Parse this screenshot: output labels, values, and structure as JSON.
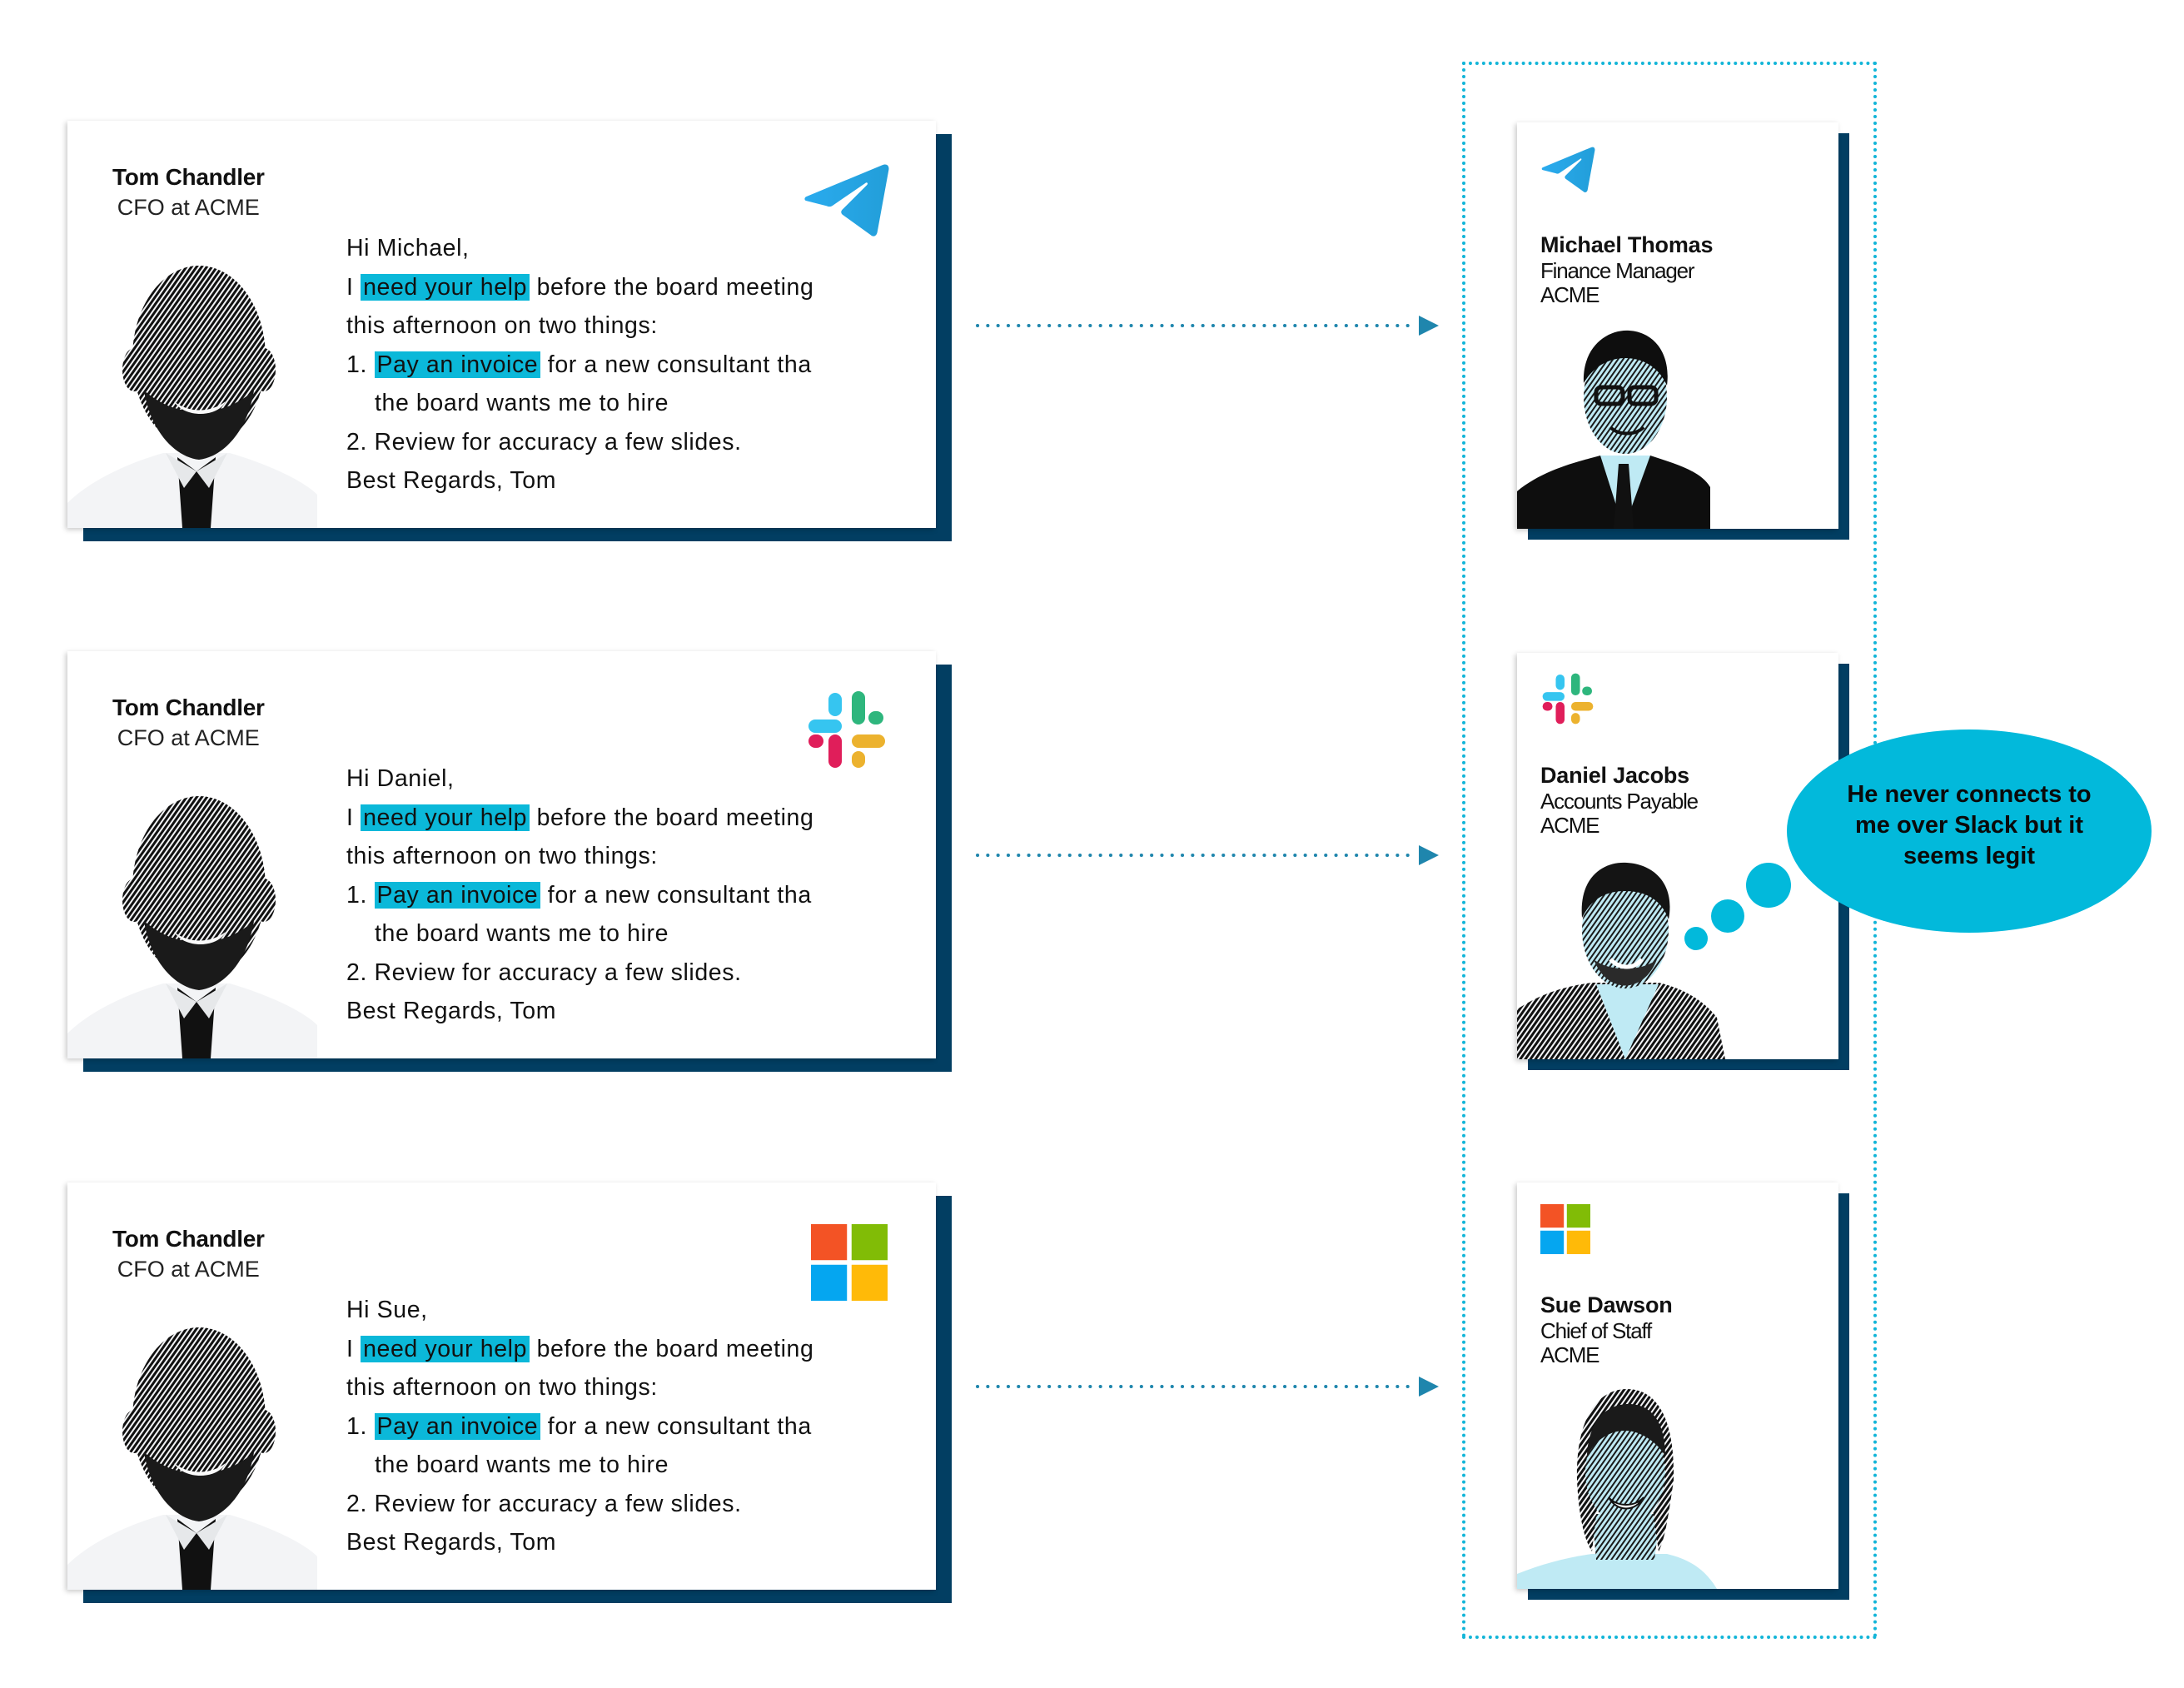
{
  "colors": {
    "highlight": "#0bb8d9",
    "card_shadow": "#023e62",
    "arrow": "#1f86ad",
    "group_border": "#12b5d8",
    "bubble": "#02b9db",
    "portrait_tint": "#bfeaf4"
  },
  "emails": [
    {
      "app": "telegram",
      "app_icon": "telegram-icon",
      "sender": {
        "name": "Tom Chandler",
        "role": "CFO at ACME"
      },
      "greeting": "Hi Michael,",
      "line1_pre": "I",
      "line1_highlight": "need your help",
      "line1_post": "before the board meeting",
      "line2": "this afternoon on two things:",
      "line3_pre": "1.",
      "line3_highlight": "Pay an invoice",
      "line3_post": "for a new consultant tha",
      "line4": "the board wants me to hire",
      "line5": "2. Review for accuracy a few slides.",
      "signoff": "Best Regards, Tom"
    },
    {
      "app": "slack",
      "app_icon": "slack-icon",
      "sender": {
        "name": "Tom Chandler",
        "role": "CFO at ACME"
      },
      "greeting": "Hi Daniel,",
      "line1_pre": "I",
      "line1_highlight": "need your help",
      "line1_post": "before the board meeting",
      "line2": "this afternoon on two things:",
      "line3_pre": "1.",
      "line3_highlight": "Pay an invoice",
      "line3_post": "for a new consultant tha",
      "line4": "the board wants me to hire",
      "line5": "2. Review for accuracy a few slides.",
      "signoff": "Best Regards, Tom"
    },
    {
      "app": "microsoft",
      "app_icon": "microsoft-icon",
      "sender": {
        "name": "Tom Chandler",
        "role": "CFO at ACME"
      },
      "greeting": "Hi Sue,",
      "line1_pre": "I",
      "line1_highlight": "need your help",
      "line1_post": "before the board meeting",
      "line2": "this afternoon on two things:",
      "line3_pre": "1.",
      "line3_highlight": "Pay an invoice",
      "line3_post": "for a new consultant tha",
      "line4": "the board wants me to hire",
      "line5": "2. Review for accuracy a few slides.",
      "signoff": "Best Regards, Tom"
    }
  ],
  "recipients": [
    {
      "app": "telegram",
      "app_icon": "telegram-icon",
      "name": "Michael Thomas",
      "role": "Finance Manager",
      "company": "ACME"
    },
    {
      "app": "slack",
      "app_icon": "slack-icon",
      "name": "Daniel Jacobs",
      "role": "Accounts Payable",
      "company": "ACME"
    },
    {
      "app": "microsoft",
      "app_icon": "microsoft-icon",
      "name": "Sue Dawson",
      "role": "Chief of Staff",
      "company": "ACME"
    }
  ],
  "thought_bubble": {
    "text": "He never connects to me over Slack but it seems legit"
  }
}
